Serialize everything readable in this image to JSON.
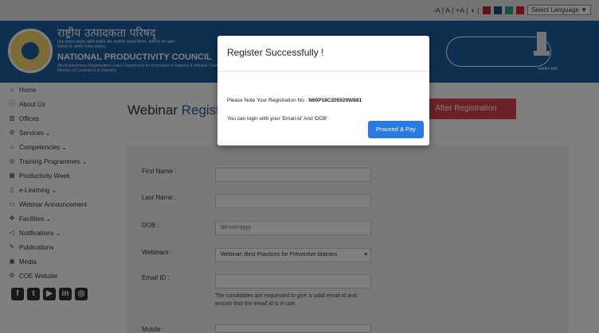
{
  "topbar": {
    "text_size": "-A | A | +A |",
    "contrast": "◐ |",
    "language": "Select Language ▼",
    "swatches": [
      "#c0262e",
      "#1b4d8f",
      "#27a58a",
      "#d9272e"
    ]
  },
  "header": {
    "hindi_title": "राष्ट्रीय उत्पादकता परिषद्",
    "hindi_sub": "(एक स्वायत्त संगठन उद्योग संवर्धन और आंतरिक व्यापार विभाग, वाणिज्य एवं उद्योग मंत्रालय के अंतर्गत (भारत सरकार)",
    "org_name": "NATIONAL PRODUCTIVITY COUNCIL",
    "org_sub": "(An Autonomous Organization Under Department for Promotion of Industry & Internal Trade, Ministry of Commerce & Industry)",
    "emblem_label": "सत्यमेव जयते"
  },
  "sidebar": {
    "items": [
      {
        "icon": "home-icon",
        "glyph": "⌂",
        "label": "Home"
      },
      {
        "icon": "info-icon",
        "glyph": "ⓘ",
        "label": "About Us"
      },
      {
        "icon": "building-icon",
        "glyph": "▥",
        "label": "Offices"
      },
      {
        "icon": "services-icon",
        "glyph": "⚙",
        "label": "Services ⌄"
      },
      {
        "icon": "institution-icon",
        "glyph": "⌂",
        "label": "Competencies ⌄"
      },
      {
        "icon": "globe-icon",
        "glyph": "◎",
        "label": "Training Programmes ⌄"
      },
      {
        "icon": "calendar-icon",
        "glyph": "▦",
        "label": "Productivity Week"
      },
      {
        "icon": "books-icon",
        "glyph": "▯",
        "label": "e-Learning ⌄"
      },
      {
        "icon": "monitor-icon",
        "glyph": "▭",
        "label": "Webinar Announcement"
      },
      {
        "icon": "facilities-icon",
        "glyph": "✥",
        "label": "Facilities ⌄"
      },
      {
        "icon": "bullhorn-icon",
        "glyph": "◁",
        "label": "Notifications ⌄"
      },
      {
        "icon": "publications-icon",
        "glyph": "✎",
        "label": "Publications"
      },
      {
        "icon": "media-icon",
        "glyph": "▣",
        "label": "Media"
      },
      {
        "icon": "gears-icon",
        "glyph": "⚙",
        "label": "COE Website"
      }
    ]
  },
  "main": {
    "title_part1": "Webinar ",
    "title_part2": "Regist",
    "after_button": "After Registration",
    "form": {
      "first_name_label": "First Name :",
      "last_name_label": "Last Name :",
      "dob_label": "DOB :",
      "dob_placeholder": "dd-mm-yyyy",
      "webinars_label": "Webinars :",
      "webinar_selected": "Webinar: Best Practices for Preventive Mainten",
      "email_label": "Email ID :",
      "email_hint": "The candidates are requested to give a valid email-id and ensure that the email id is in use.",
      "mobile_label": "Mobile :"
    }
  },
  "modal": {
    "title": "Register Successfully !",
    "reg_prefix": "Please Note Your Registration No : ",
    "reg_no": "N60P18C205929W881",
    "login_text": "You can login with your 'Email-Id' And 'DOB'",
    "proceed_button": "Proceed & Pay"
  }
}
